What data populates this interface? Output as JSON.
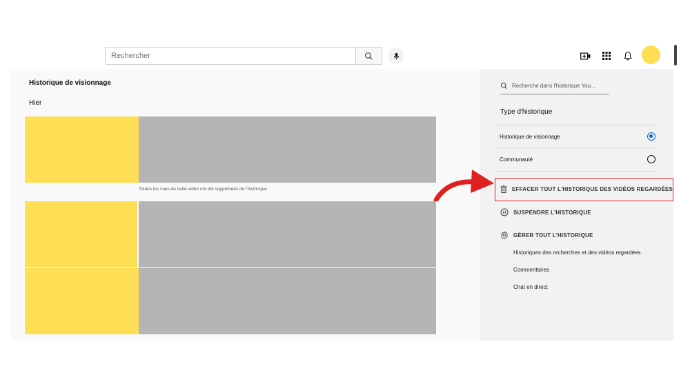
{
  "header": {
    "search_placeholder": "Rechercher",
    "icons": [
      "search-icon",
      "microphone-icon",
      "create-video-icon",
      "apps-grid-icon",
      "notifications-bell-icon"
    ]
  },
  "main": {
    "title": "Historique de visionnage",
    "day_label": "Hier",
    "removed_notice": "Toutes les vues de cette vidéo ont été supprimées de l'historique"
  },
  "sidebar": {
    "search_placeholder": "Recherche dans l'historique You...",
    "history_type_heading": "Type d'historique",
    "history_types": [
      {
        "label": "Historique de visionnage",
        "selected": true
      },
      {
        "label": "Communauté",
        "selected": false
      }
    ],
    "actions": {
      "clear_all": "EFFACER TOUT L'HISTORIQUE DES VIDÉOS REGARDÉES",
      "pause": "SUSPENDRE L'HISTORIQUE",
      "manage": "GÉRER TOUT L'HISTORIQUE"
    },
    "sub_links": [
      "Historiques des recherches et des vidéos regardées",
      "Commentaires",
      "Chat en direct"
    ]
  },
  "colors": {
    "thumbnail": "#fdde55",
    "highlight": "#e02020",
    "radio_selected": "#065fd4"
  }
}
